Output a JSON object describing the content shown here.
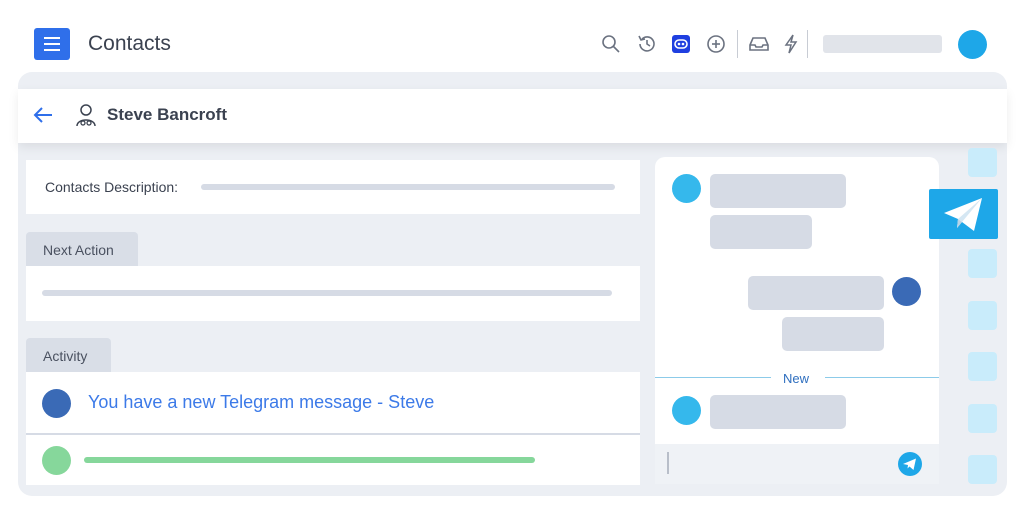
{
  "header": {
    "title": "Contacts",
    "icons": [
      "search-icon",
      "history-icon",
      "bot-icon",
      "add-circle-icon",
      "inbox-icon",
      "lightning-icon"
    ],
    "accent": "#2f6fea"
  },
  "contact": {
    "name": "Steve Bancroft"
  },
  "description": {
    "label": "Contacts Description:"
  },
  "next_action": {
    "tab_label": "Next Action"
  },
  "activity": {
    "tab_label": "Activity",
    "message": "You have a new Telegram message - Steve"
  },
  "chat": {
    "divider_label": "New",
    "brand_color": "#1ea7e8"
  }
}
